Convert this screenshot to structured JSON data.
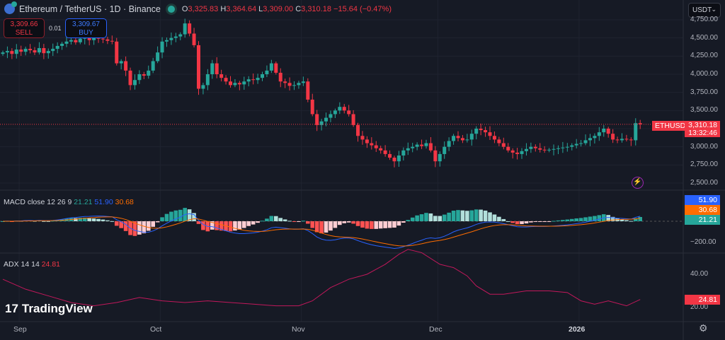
{
  "header": {
    "symbol": "Ethereum / TetherUS · 1D · Binance",
    "o_label": "O",
    "o": "3,325.83",
    "h_label": "H",
    "h": "3,364.64",
    "l_label": "L",
    "l": "3,309.00",
    "c_label": "C",
    "c": "3,310.18",
    "change": "−15.64 (−0.47%)"
  },
  "trade": {
    "sell_price": "3,309.66",
    "sell_label": "SELL",
    "buy_price": "3,309.67",
    "buy_label": "BUY",
    "quantity": "0.01"
  },
  "currency_select": "USDT",
  "price_axis": [
    "4,750.00",
    "4,500.00",
    "4,250.00",
    "4,000.00",
    "3,750.00",
    "3,500.00",
    "3,000.00",
    "2,750.00",
    "2,500.00"
  ],
  "last_price": {
    "symbol": "ETHUSDT",
    "price": "3,310.18",
    "countdown": "13:32:46"
  },
  "macd": {
    "label": "MACD close 12 26 9",
    "hist": "21.21",
    "macd": "51.90",
    "signal": "30.68",
    "axis": "−200.00"
  },
  "adx": {
    "label": "ADX 14 14",
    "value": "24.81",
    "axis": [
      "40.00",
      "20.00"
    ]
  },
  "time_axis": [
    "Sep",
    "Oct",
    "Nov",
    "Dec",
    "2026"
  ],
  "brand": "TradingView",
  "colors": {
    "up": "#26a69a",
    "down": "#f23645",
    "macd": "#2962ff",
    "signal": "#ff6d00",
    "adx": "#f23645"
  },
  "chart_data": {
    "type": "candlestick",
    "closes": [
      4300,
      4320,
      4280,
      4340,
      4310,
      4350,
      4330,
      4300,
      4360,
      4290,
      4320,
      4350,
      4390,
      4420,
      4450,
      4470,
      4440,
      4490,
      4500,
      4470,
      4500,
      4490,
      4480,
      4460,
      4450,
      4150,
      4180,
      4050,
      3850,
      3920,
      4000,
      3980,
      4050,
      4180,
      4300,
      4450,
      4470,
      4500,
      4520,
      4550,
      4700,
      4560,
      4400,
      3800,
      3850,
      4000,
      4150,
      4000,
      3950,
      3900,
      3850,
      3880,
      3860,
      3900,
      3930,
      3920,
      3950,
      4000,
      4050,
      4150,
      4020,
      3900,
      3880,
      3840,
      3850,
      3880,
      3900,
      3650,
      3450,
      3300,
      3350,
      3400,
      3450,
      3500,
      3550,
      3500,
      3450,
      3300,
      3150,
      3100,
      3050,
      3020,
      2980,
      2950,
      2900,
      2850,
      2800,
      2880,
      2950,
      2980,
      3000,
      3030,
      3010,
      3050,
      2950,
      2800,
      2900,
      3000,
      3080,
      3150,
      3120,
      3090,
      3100,
      3180,
      3250,
      3230,
      3200,
      3150,
      3100,
      3050,
      3000,
      2950,
      2920,
      2900,
      2940,
      2970,
      3000,
      2980,
      2960,
      2950,
      2960,
      2970,
      2980,
      2990,
      3000,
      3020,
      3040,
      3050,
      3090,
      3120,
      3150,
      3200,
      3250,
      3180,
      3100,
      3090,
      3110,
      3100,
      3090,
      3325.83,
      3310.18
    ],
    "adx_points": [
      [
        0,
        37
      ],
      [
        5,
        31
      ],
      [
        10,
        27
      ],
      [
        15,
        23
      ],
      [
        20,
        21
      ],
      [
        25,
        23
      ],
      [
        30,
        26
      ],
      [
        35,
        24
      ],
      [
        40,
        23
      ],
      [
        45,
        24
      ],
      [
        50,
        23
      ],
      [
        55,
        22
      ],
      [
        60,
        21
      ],
      [
        65,
        21
      ],
      [
        68,
        24
      ],
      [
        72,
        32
      ],
      [
        76,
        37
      ],
      [
        80,
        40
      ],
      [
        84,
        46
      ],
      [
        87,
        52
      ],
      [
        89,
        55
      ],
      [
        92,
        53
      ],
      [
        96,
        46
      ],
      [
        99,
        44
      ],
      [
        102,
        39
      ],
      [
        104,
        33
      ],
      [
        107,
        28
      ],
      [
        110,
        28
      ],
      [
        115,
        30
      ],
      [
        120,
        30
      ],
      [
        124,
        29
      ],
      [
        127,
        24
      ],
      [
        130,
        22
      ],
      [
        133,
        24
      ],
      [
        137,
        21
      ],
      [
        140,
        24.81
      ]
    ],
    "price_range": [
      2500,
      4750
    ]
  }
}
